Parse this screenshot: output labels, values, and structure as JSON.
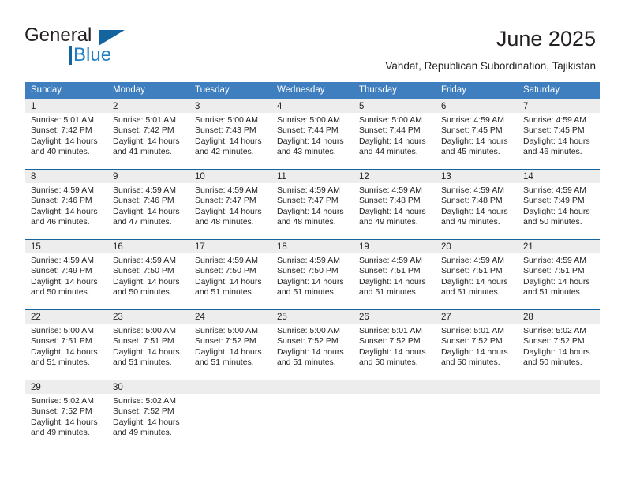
{
  "brand": {
    "name_part1": "General",
    "name_part2": "Blue",
    "triangle_icon": "blue-triangle-icon",
    "accent_dark": "#1464a0",
    "accent_light": "#1f7fc4"
  },
  "header": {
    "title": "June 2025",
    "subtitle": "Vahdat, Republican Subordination, Tajikistan"
  },
  "calendar": {
    "header_bg": "#3f7fbf",
    "header_text_color": "#ffffff",
    "daynum_band_bg": "#ededed",
    "row_border_color": "#1464a0",
    "weekday_headers": [
      "Sunday",
      "Monday",
      "Tuesday",
      "Wednesday",
      "Thursday",
      "Friday",
      "Saturday"
    ],
    "weeks": [
      [
        {
          "day": "1",
          "sunrise": "Sunrise: 5:01 AM",
          "sunset": "Sunset: 7:42 PM",
          "daylight_line1": "Daylight: 14 hours",
          "daylight_line2": "and 40 minutes."
        },
        {
          "day": "2",
          "sunrise": "Sunrise: 5:01 AM",
          "sunset": "Sunset: 7:42 PM",
          "daylight_line1": "Daylight: 14 hours",
          "daylight_line2": "and 41 minutes."
        },
        {
          "day": "3",
          "sunrise": "Sunrise: 5:00 AM",
          "sunset": "Sunset: 7:43 PM",
          "daylight_line1": "Daylight: 14 hours",
          "daylight_line2": "and 42 minutes."
        },
        {
          "day": "4",
          "sunrise": "Sunrise: 5:00 AM",
          "sunset": "Sunset: 7:44 PM",
          "daylight_line1": "Daylight: 14 hours",
          "daylight_line2": "and 43 minutes."
        },
        {
          "day": "5",
          "sunrise": "Sunrise: 5:00 AM",
          "sunset": "Sunset: 7:44 PM",
          "daylight_line1": "Daylight: 14 hours",
          "daylight_line2": "and 44 minutes."
        },
        {
          "day": "6",
          "sunrise": "Sunrise: 4:59 AM",
          "sunset": "Sunset: 7:45 PM",
          "daylight_line1": "Daylight: 14 hours",
          "daylight_line2": "and 45 minutes."
        },
        {
          "day": "7",
          "sunrise": "Sunrise: 4:59 AM",
          "sunset": "Sunset: 7:45 PM",
          "daylight_line1": "Daylight: 14 hours",
          "daylight_line2": "and 46 minutes."
        }
      ],
      [
        {
          "day": "8",
          "sunrise": "Sunrise: 4:59 AM",
          "sunset": "Sunset: 7:46 PM",
          "daylight_line1": "Daylight: 14 hours",
          "daylight_line2": "and 46 minutes."
        },
        {
          "day": "9",
          "sunrise": "Sunrise: 4:59 AM",
          "sunset": "Sunset: 7:46 PM",
          "daylight_line1": "Daylight: 14 hours",
          "daylight_line2": "and 47 minutes."
        },
        {
          "day": "10",
          "sunrise": "Sunrise: 4:59 AM",
          "sunset": "Sunset: 7:47 PM",
          "daylight_line1": "Daylight: 14 hours",
          "daylight_line2": "and 48 minutes."
        },
        {
          "day": "11",
          "sunrise": "Sunrise: 4:59 AM",
          "sunset": "Sunset: 7:47 PM",
          "daylight_line1": "Daylight: 14 hours",
          "daylight_line2": "and 48 minutes."
        },
        {
          "day": "12",
          "sunrise": "Sunrise: 4:59 AM",
          "sunset": "Sunset: 7:48 PM",
          "daylight_line1": "Daylight: 14 hours",
          "daylight_line2": "and 49 minutes."
        },
        {
          "day": "13",
          "sunrise": "Sunrise: 4:59 AM",
          "sunset": "Sunset: 7:48 PM",
          "daylight_line1": "Daylight: 14 hours",
          "daylight_line2": "and 49 minutes."
        },
        {
          "day": "14",
          "sunrise": "Sunrise: 4:59 AM",
          "sunset": "Sunset: 7:49 PM",
          "daylight_line1": "Daylight: 14 hours",
          "daylight_line2": "and 50 minutes."
        }
      ],
      [
        {
          "day": "15",
          "sunrise": "Sunrise: 4:59 AM",
          "sunset": "Sunset: 7:49 PM",
          "daylight_line1": "Daylight: 14 hours",
          "daylight_line2": "and 50 minutes."
        },
        {
          "day": "16",
          "sunrise": "Sunrise: 4:59 AM",
          "sunset": "Sunset: 7:50 PM",
          "daylight_line1": "Daylight: 14 hours",
          "daylight_line2": "and 50 minutes."
        },
        {
          "day": "17",
          "sunrise": "Sunrise: 4:59 AM",
          "sunset": "Sunset: 7:50 PM",
          "daylight_line1": "Daylight: 14 hours",
          "daylight_line2": "and 51 minutes."
        },
        {
          "day": "18",
          "sunrise": "Sunrise: 4:59 AM",
          "sunset": "Sunset: 7:50 PM",
          "daylight_line1": "Daylight: 14 hours",
          "daylight_line2": "and 51 minutes."
        },
        {
          "day": "19",
          "sunrise": "Sunrise: 4:59 AM",
          "sunset": "Sunset: 7:51 PM",
          "daylight_line1": "Daylight: 14 hours",
          "daylight_line2": "and 51 minutes."
        },
        {
          "day": "20",
          "sunrise": "Sunrise: 4:59 AM",
          "sunset": "Sunset: 7:51 PM",
          "daylight_line1": "Daylight: 14 hours",
          "daylight_line2": "and 51 minutes."
        },
        {
          "day": "21",
          "sunrise": "Sunrise: 4:59 AM",
          "sunset": "Sunset: 7:51 PM",
          "daylight_line1": "Daylight: 14 hours",
          "daylight_line2": "and 51 minutes."
        }
      ],
      [
        {
          "day": "22",
          "sunrise": "Sunrise: 5:00 AM",
          "sunset": "Sunset: 7:51 PM",
          "daylight_line1": "Daylight: 14 hours",
          "daylight_line2": "and 51 minutes."
        },
        {
          "day": "23",
          "sunrise": "Sunrise: 5:00 AM",
          "sunset": "Sunset: 7:51 PM",
          "daylight_line1": "Daylight: 14 hours",
          "daylight_line2": "and 51 minutes."
        },
        {
          "day": "24",
          "sunrise": "Sunrise: 5:00 AM",
          "sunset": "Sunset: 7:52 PM",
          "daylight_line1": "Daylight: 14 hours",
          "daylight_line2": "and 51 minutes."
        },
        {
          "day": "25",
          "sunrise": "Sunrise: 5:00 AM",
          "sunset": "Sunset: 7:52 PM",
          "daylight_line1": "Daylight: 14 hours",
          "daylight_line2": "and 51 minutes."
        },
        {
          "day": "26",
          "sunrise": "Sunrise: 5:01 AM",
          "sunset": "Sunset: 7:52 PM",
          "daylight_line1": "Daylight: 14 hours",
          "daylight_line2": "and 50 minutes."
        },
        {
          "day": "27",
          "sunrise": "Sunrise: 5:01 AM",
          "sunset": "Sunset: 7:52 PM",
          "daylight_line1": "Daylight: 14 hours",
          "daylight_line2": "and 50 minutes."
        },
        {
          "day": "28",
          "sunrise": "Sunrise: 5:02 AM",
          "sunset": "Sunset: 7:52 PM",
          "daylight_line1": "Daylight: 14 hours",
          "daylight_line2": "and 50 minutes."
        }
      ],
      [
        {
          "day": "29",
          "sunrise": "Sunrise: 5:02 AM",
          "sunset": "Sunset: 7:52 PM",
          "daylight_line1": "Daylight: 14 hours",
          "daylight_line2": "and 49 minutes."
        },
        {
          "day": "30",
          "sunrise": "Sunrise: 5:02 AM",
          "sunset": "Sunset: 7:52 PM",
          "daylight_line1": "Daylight: 14 hours",
          "daylight_line2": "and 49 minutes."
        },
        {
          "day": "",
          "sunrise": "",
          "sunset": "",
          "daylight_line1": "",
          "daylight_line2": ""
        },
        {
          "day": "",
          "sunrise": "",
          "sunset": "",
          "daylight_line1": "",
          "daylight_line2": ""
        },
        {
          "day": "",
          "sunrise": "",
          "sunset": "",
          "daylight_line1": "",
          "daylight_line2": ""
        },
        {
          "day": "",
          "sunrise": "",
          "sunset": "",
          "daylight_line1": "",
          "daylight_line2": ""
        },
        {
          "day": "",
          "sunrise": "",
          "sunset": "",
          "daylight_line1": "",
          "daylight_line2": ""
        }
      ]
    ]
  }
}
